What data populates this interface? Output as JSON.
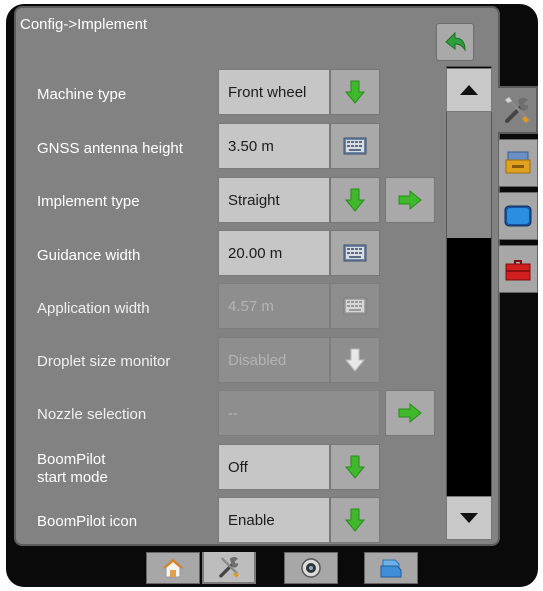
{
  "header": {
    "title": "Config->Implement"
  },
  "rows": [
    {
      "label": "Machine type",
      "value": "Front wheel",
      "control": "dropdown",
      "state": "enabled"
    },
    {
      "label": "GNSS antenna height",
      "value": "3.50 m",
      "control": "keyboard",
      "state": "enabled"
    },
    {
      "label": "Implement type",
      "value": "Straight",
      "control": "dropdown",
      "state": "enabled",
      "extra": "goto"
    },
    {
      "label": "Guidance width",
      "value": "20.00 m",
      "control": "keyboard",
      "state": "enabled"
    },
    {
      "label": "Application width",
      "value": "4.57 m",
      "control": "keyboard",
      "state": "disabled"
    },
    {
      "label": "Droplet size monitor",
      "value": "Disabled",
      "control": "dropdown",
      "state": "disabled"
    },
    {
      "label": "Nozzle selection",
      "value": "--",
      "control": "none",
      "state": "disabled",
      "extra": "goto"
    },
    {
      "label_line1": "BoomPilot",
      "label_line2": "start mode",
      "value": "Off",
      "control": "dropdown",
      "state": "enabled"
    },
    {
      "label": "BoomPilot icon",
      "value": "Enable",
      "control": "dropdown",
      "state": "enabled"
    }
  ],
  "icons": {
    "back": "back-arrow-icon",
    "dropdown": "down-arrow-icon",
    "keyboard": "keyboard-icon",
    "goto": "right-arrow-icon",
    "scroll_up": "scroll-up-icon",
    "scroll_down": "scroll-down-icon",
    "side_tabs": [
      "tools-icon",
      "console-icon",
      "display-icon",
      "toolbox-icon"
    ],
    "bottom_tabs": [
      "home-icon",
      "tools-icon",
      "camera-icon",
      "layers-icon"
    ]
  },
  "colors": {
    "panel": "#828282",
    "field": "#c6c6c6",
    "button": "#a9a9a9",
    "arrow_green": "#3fb82c",
    "back_green": "#2e9f3a",
    "background": "#0a0a0a"
  }
}
